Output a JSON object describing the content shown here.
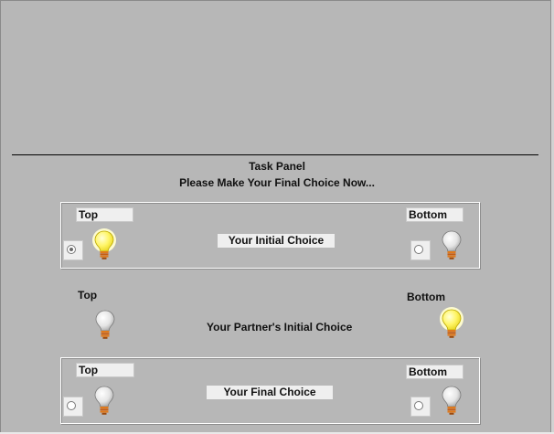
{
  "task_panel": {
    "title": "Task Panel",
    "instruction": "Please Make Your Final Choice Now..."
  },
  "initial_choice": {
    "top_label": "Top",
    "bottom_label": "Bottom",
    "center_label": "Your Initial Choice",
    "top_selected": true,
    "bottom_selected": false,
    "top_bulb": "lit-bulb-icon",
    "bottom_bulb": "unlit-bulb-icon"
  },
  "partner_choice": {
    "top_label": "Top",
    "bottom_label": "Bottom",
    "center_label": "Your Partner's Initial Choice",
    "top_bulb": "unlit-bulb-icon",
    "bottom_bulb": "lit-bulb-icon"
  },
  "final_choice": {
    "top_label": "Top",
    "bottom_label": "Bottom",
    "center_label": "Your Final Choice",
    "top_selected": false,
    "bottom_selected": false,
    "top_bulb": "unlit-bulb-icon",
    "bottom_bulb": "unlit-bulb-icon"
  },
  "colors": {
    "background": "#b7b7b7",
    "bulb_lit": "#fff566",
    "bulb_unlit": "#e4e4e4",
    "bulb_base": "#e07a1c"
  }
}
